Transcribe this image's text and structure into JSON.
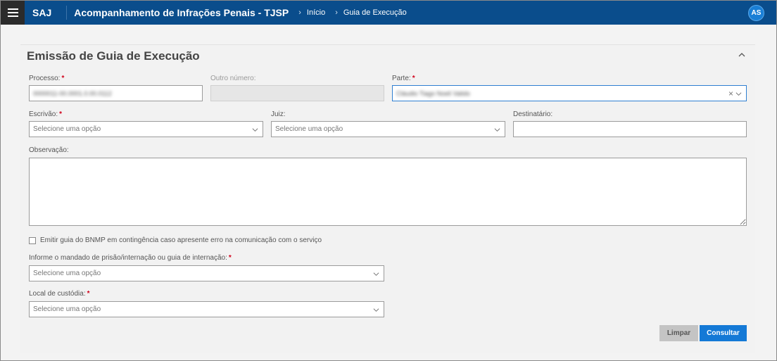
{
  "header": {
    "brand": "SAJ",
    "app_title": "Acompanhamento de Infrações Penais - TJSP",
    "breadcrumb": [
      "Início",
      "Guia de Execução"
    ],
    "avatar_initials": "AS",
    "bar_color": "#0a4d8c"
  },
  "form": {
    "title": "Emissão de Guia de Execução",
    "processo": {
      "label": "Processo:",
      "value": "0000011-00.0001.0.00.0112"
    },
    "outro_numero": {
      "label": "Outro número:",
      "value": ""
    },
    "parte": {
      "label": "Parte:",
      "value": "Cláudio Tiago Noeli Valido"
    },
    "escrivao": {
      "label": "Escrivão:",
      "placeholder": "Selecione uma opção"
    },
    "juiz": {
      "label": "Juiz:",
      "placeholder": "Selecione uma opção"
    },
    "destinatario": {
      "label": "Destinatário:",
      "value": ""
    },
    "observacao": {
      "label": "Observação:",
      "value": ""
    },
    "contingencia_label": "Emitir guia do BNMP em contingência caso apresente erro na comunicação com o serviço",
    "mandado": {
      "label": "Informe o mandado de prisão/internação ou guia de internação:",
      "placeholder": "Selecione uma opção"
    },
    "local_custodia": {
      "label": "Local de custódia:",
      "placeholder": "Selecione uma opção"
    },
    "required_mark": "*"
  },
  "actions": {
    "clear_label": "Limpar",
    "submit_label": "Consultar",
    "primary_color": "#1479d6"
  }
}
